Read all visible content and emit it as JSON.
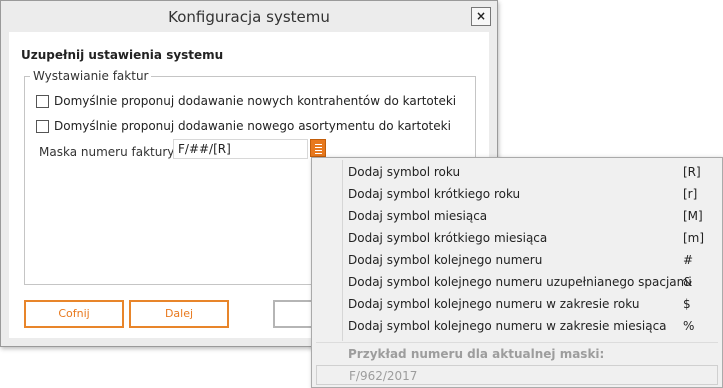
{
  "window": {
    "title": "Konfiguracja systemu",
    "close_label": "×"
  },
  "form": {
    "heading": "Uzupełnij ustawienia systemu",
    "group_label": "Wystawianie faktur",
    "checkboxes": [
      {
        "label": "Domyślnie proponuj dodawanie nowych kontrahentów do kartoteki",
        "checked": false
      },
      {
        "label": "Domyślnie proponuj dodawanie nowego asortymentu do kartoteki",
        "checked": false
      }
    ],
    "mask_label": "Maska numeru faktury",
    "mask_value": "F/##/[R]",
    "menu_icon": "menu-list-icon"
  },
  "buttons": {
    "back": "Cofnij",
    "next": "Dalej",
    "third": ""
  },
  "popup": {
    "items": [
      {
        "label": "Dodaj symbol roku",
        "shortcut": "[R]"
      },
      {
        "label": "Dodaj symbol krótkiego roku",
        "shortcut": "[r]"
      },
      {
        "label": "Dodaj symbol miesiąca",
        "shortcut": "[M]"
      },
      {
        "label": "Dodaj symbol krótkiego miesiąca",
        "shortcut": "[m]"
      },
      {
        "label": "Dodaj symbol kolejnego numeru",
        "shortcut": "#"
      },
      {
        "label": "Dodaj symbol kolejnego numeru uzupełnianego spacjami",
        "shortcut": "&"
      },
      {
        "label": "Dodaj symbol kolejnego numeru w zakresie roku",
        "shortcut": "$"
      },
      {
        "label": "Dodaj symbol kolejnego numeru w zakresie miesiąca",
        "shortcut": "%"
      }
    ],
    "example_label": "Przykład numeru dla aktualnej maski:",
    "example_value": "F/962/2017"
  },
  "colors": {
    "accent": "#e8791e",
    "window_bg": "#ececec",
    "popup_bg": "#f0f0f0"
  }
}
